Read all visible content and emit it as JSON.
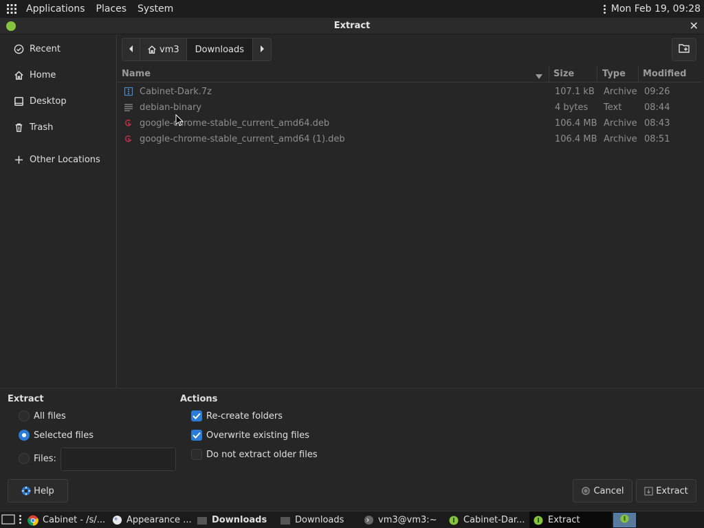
{
  "top_panel": {
    "menus": [
      "Applications",
      "Places",
      "System"
    ],
    "clock": "Mon Feb 19, 09:28"
  },
  "window": {
    "title": "Extract",
    "close_glyph": "✕"
  },
  "sidebar": {
    "items": [
      {
        "label": "Recent",
        "icon": "clock-icon"
      },
      {
        "label": "Home",
        "icon": "home-icon"
      },
      {
        "label": "Desktop",
        "icon": "desktop-icon"
      },
      {
        "label": "Trash",
        "icon": "trash-icon"
      },
      {
        "label": "Other Locations",
        "icon": "plus-icon"
      }
    ]
  },
  "pathbar": {
    "segments": [
      "vm3",
      "Downloads"
    ]
  },
  "file_list": {
    "columns": {
      "name": "Name",
      "size": "Size",
      "type": "Type",
      "modified": "Modified"
    },
    "rows": [
      {
        "name": "Cabinet-Dark.7z",
        "size": "107.1 kB",
        "type": "Archive",
        "modified": "09:26",
        "icon": "archive-icon"
      },
      {
        "name": "debian-binary",
        "size": "4 bytes",
        "type": "Text",
        "modified": "08:44",
        "icon": "text-file-icon"
      },
      {
        "name": "google-chrome-stable_current_amd64.deb",
        "size": "106.4 MB",
        "type": "Archive",
        "modified": "08:43",
        "icon": "debian-package-icon"
      },
      {
        "name": "google-chrome-stable_current_amd64 (1).deb",
        "size": "106.4 MB",
        "type": "Archive",
        "modified": "08:51",
        "icon": "debian-package-icon"
      }
    ]
  },
  "extract_section": {
    "title": "Extract",
    "options": [
      {
        "label": "All files",
        "selected": false
      },
      {
        "label": "Selected files",
        "selected": true
      },
      {
        "label": "Files:",
        "selected": false
      }
    ],
    "files_input_value": ""
  },
  "actions_section": {
    "title": "Actions",
    "options": [
      {
        "label": "Re-create folders",
        "checked": true
      },
      {
        "label": "Overwrite existing files",
        "checked": true
      },
      {
        "label": "Do not extract older files",
        "checked": false
      }
    ]
  },
  "buttons": {
    "help": "Help",
    "cancel": "Cancel",
    "extract": "Extract"
  },
  "taskbar": {
    "tasks": [
      {
        "label": "Cabinet - /s/...",
        "icon": "chrome-icon",
        "active": false,
        "bold": false
      },
      {
        "label": "Appearance ...",
        "icon": "appearance-icon",
        "active": false,
        "bold": false
      },
      {
        "label": "Downloads",
        "icon": "folder-icon",
        "active": false,
        "bold": true
      },
      {
        "label": "Downloads",
        "icon": "folder-icon",
        "active": false,
        "bold": false
      },
      {
        "label": "vm3@vm3:~",
        "icon": "terminal-icon",
        "active": false,
        "bold": false
      },
      {
        "label": "Cabinet-Dar...",
        "icon": "cabinet-icon",
        "active": false,
        "bold": false
      },
      {
        "label": "Extract",
        "icon": "cabinet-icon",
        "active": true,
        "bold": false
      }
    ]
  },
  "colors": {
    "accent": "#2a7cd6",
    "brand_green": "#86c43f",
    "debian_red": "#c9304a"
  }
}
